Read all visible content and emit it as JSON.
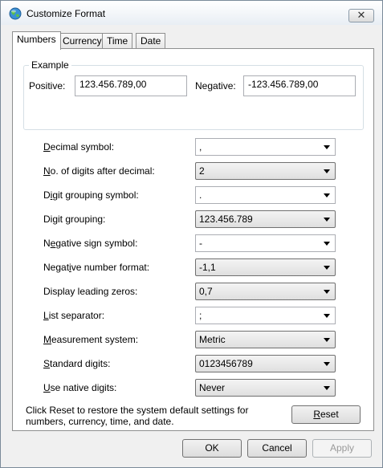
{
  "window": {
    "title": "Customize Format",
    "close_glyph": "✕"
  },
  "tabs": [
    {
      "label": "Numbers",
      "active": true
    },
    {
      "label": "Currency",
      "active": false
    },
    {
      "label": "Time",
      "active": false
    },
    {
      "label": "Date",
      "active": false
    }
  ],
  "example": {
    "title": "Example",
    "positive_label": "Positive:",
    "positive_value": "123.456.789,00",
    "negative_label": "Negative:",
    "negative_value": "-123.456.789,00"
  },
  "settings": [
    {
      "label_pre": "",
      "label_key": "D",
      "label_post": "ecimal symbol:",
      "value": ",",
      "readonly": false
    },
    {
      "label_pre": "",
      "label_key": "N",
      "label_post": "o. of digits after decimal:",
      "value": "2",
      "readonly": true
    },
    {
      "label_pre": "D",
      "label_key": "i",
      "label_post": "git grouping symbol:",
      "value": ".",
      "readonly": false
    },
    {
      "label_pre": "Digit grouping:",
      "label_key": "",
      "label_post": "",
      "value": "123.456.789",
      "readonly": true
    },
    {
      "label_pre": "N",
      "label_key": "e",
      "label_post": "gative sign symbol:",
      "value": "-",
      "readonly": false
    },
    {
      "label_pre": "Negat",
      "label_key": "i",
      "label_post": "ve number format:",
      "value": "-1,1",
      "readonly": true
    },
    {
      "label_pre": "Display leading zeros:",
      "label_key": "",
      "label_post": "",
      "value": "0,7",
      "readonly": true
    },
    {
      "label_pre": "",
      "label_key": "L",
      "label_post": "ist separator:",
      "value": ";",
      "readonly": false
    },
    {
      "label_pre": "",
      "label_key": "M",
      "label_post": "easurement system:",
      "value": "Metric",
      "readonly": true
    },
    {
      "label_pre": "",
      "label_key": "S",
      "label_post": "tandard digits:",
      "value": "0123456789",
      "readonly": true
    },
    {
      "label_pre": "",
      "label_key": "U",
      "label_post": "se native digits:",
      "value": "Never",
      "readonly": true
    }
  ],
  "note": "Click Reset to restore the system default settings for numbers, currency, time, and date.",
  "buttons": {
    "reset_key": "R",
    "reset_rest": "eset",
    "ok": "OK",
    "cancel": "Cancel",
    "apply": "Apply"
  },
  "icons": {
    "title_icon": "globe-icon",
    "dropdown_icon": "dropdown-arrow-icon"
  }
}
